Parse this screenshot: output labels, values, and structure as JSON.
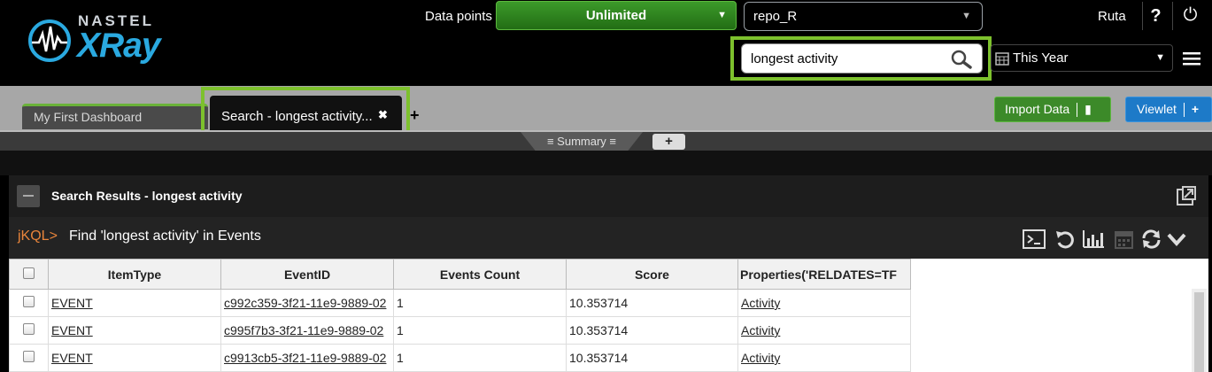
{
  "header": {
    "logo_small": "NASTEL",
    "logo_big": "XRay",
    "data_points_label": "Data points",
    "data_points_value": "Unlimited",
    "repo_value": "repo_R",
    "user": "Ruta",
    "help": "?",
    "search_value": "longest activity",
    "time_range": "This Year"
  },
  "tabs": [
    {
      "label": "My First Dashboard",
      "active": false
    },
    {
      "label": "Search - longest activity...",
      "active": true
    }
  ],
  "tab_add": "+",
  "toolbar": {
    "import_label": "Import Data",
    "viewlet_label": "Viewlet"
  },
  "subtabs": {
    "summary": "≡ Summary ≡",
    "add": "+"
  },
  "panel": {
    "title": "Search Results -  longest activity",
    "jkql_prompt": "jKQL>",
    "query": "Find 'longest activity' in  Events"
  },
  "table": {
    "columns": [
      "ItemType",
      "EventID",
      "Events Count",
      "Score",
      "Properties('RELDATES=TF"
    ],
    "rows": [
      {
        "item_type": "EVENT",
        "event_id": "c992c359-3f21-11e9-9889-02",
        "count": "1",
        "score": "10.353714",
        "properties": "Activity"
      },
      {
        "item_type": "EVENT",
        "event_id": "c995f7b3-3f21-11e9-9889-02",
        "count": "1",
        "score": "10.353714",
        "properties": "Activity"
      },
      {
        "item_type": "EVENT",
        "event_id": "c9913cb5-3f21-11e9-9889-02",
        "count": "1",
        "score": "10.353714",
        "properties": "Activity"
      }
    ]
  },
  "colors": {
    "highlight": "#7dc12d",
    "brand": "#2aa9e0",
    "jkql": "#e9853b",
    "import": "#3c8a29",
    "viewlet": "#1d7ac8"
  }
}
